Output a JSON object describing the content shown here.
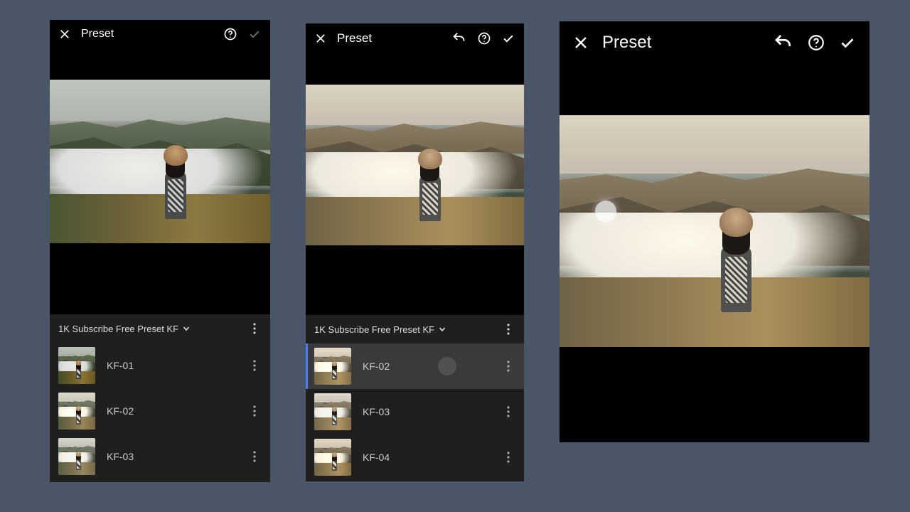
{
  "title": "Preset",
  "group_name": "1K Subscribe Free Preset KF",
  "phone1": {
    "items": [
      {
        "label": "KF-01"
      },
      {
        "label": "KF-02"
      },
      {
        "label": "KF-03"
      }
    ]
  },
  "phone2": {
    "items": [
      {
        "label": "KF-02"
      },
      {
        "label": "KF-03"
      },
      {
        "label": "KF-04"
      }
    ]
  }
}
